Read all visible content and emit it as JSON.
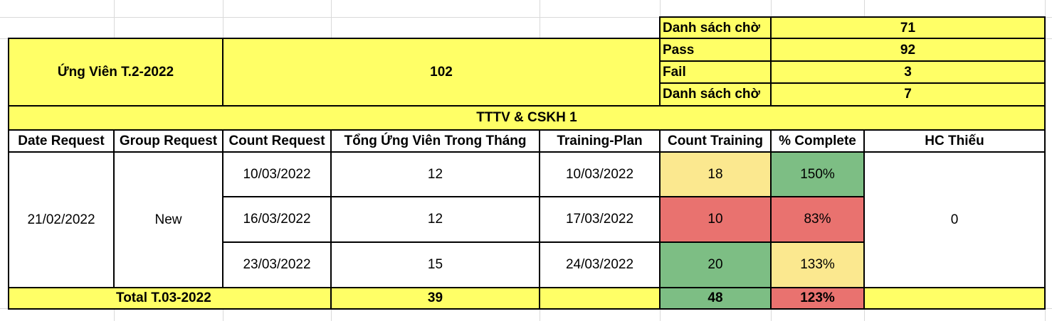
{
  "summary": {
    "label": "Ứng Viên T.2-2022",
    "value": "102",
    "stats": [
      {
        "label": "Danh sách chờ",
        "value": "71"
      },
      {
        "label": "Pass",
        "value": "92"
      },
      {
        "label": "Fail",
        "value": "3"
      },
      {
        "label": "Danh sách chờ",
        "value": "7"
      }
    ]
  },
  "section_title": "TTTV & CSKH 1",
  "headers": [
    "Date Request",
    "Group Request",
    "Count Request",
    "Tổng Ứng Viên Trong Tháng",
    "Training-Plan",
    "Count Training",
    "% Complete",
    "HC Thiếu"
  ],
  "group": {
    "date_request": "21/02/2022",
    "group_request": "New",
    "hc_thieu": "0"
  },
  "rows": [
    {
      "count_request": "10/03/2022",
      "tong_ung_vien": "12",
      "training_plan": "10/03/2022",
      "count_training": "18",
      "complete": "150%"
    },
    {
      "count_request": "16/03/2022",
      "tong_ung_vien": "12",
      "training_plan": "17/03/2022",
      "count_training": "10",
      "complete": "83%"
    },
    {
      "count_request": "23/03/2022",
      "tong_ung_vien": "15",
      "training_plan": "24/03/2022",
      "count_training": "20",
      "complete": "133%"
    }
  ],
  "total": {
    "label": "Total T.03-2022",
    "tong_ung_vien": "39",
    "count_training": "48",
    "complete": "123%"
  },
  "colors": {
    "yellow": "#ffff66",
    "green": "#7dbe84",
    "red": "#e9726f",
    "light_yellow": "#fbe88f",
    "gridline": "#d9d9d9"
  }
}
